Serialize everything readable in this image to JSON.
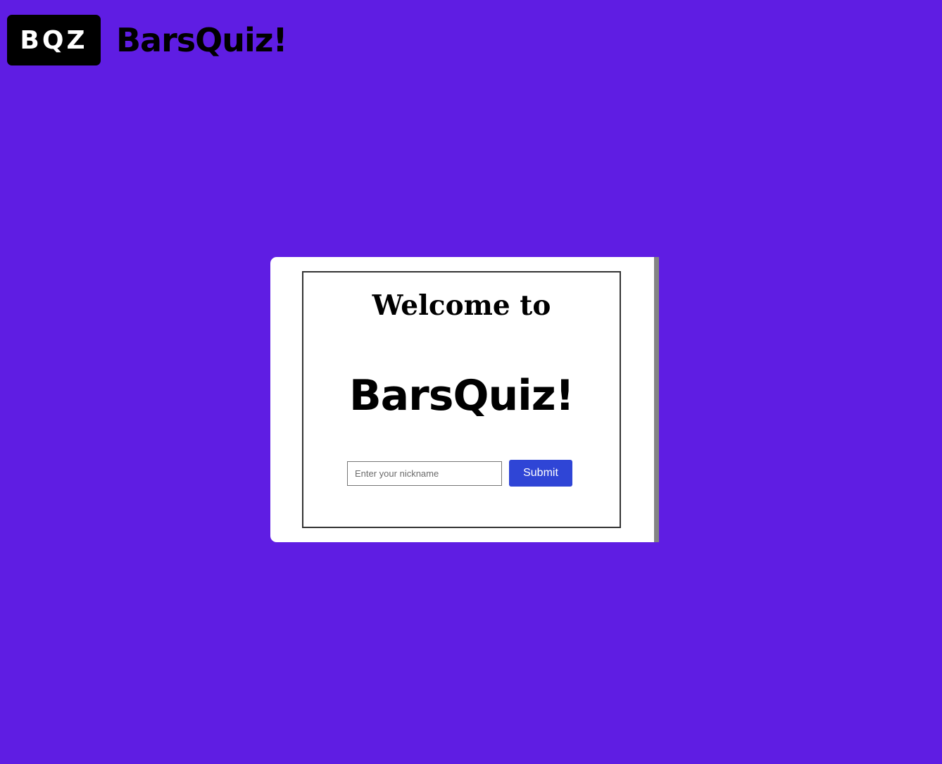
{
  "header": {
    "badge_text": "BQZ",
    "wordmark": "BarsQuiz!"
  },
  "card": {
    "welcome_text": "Welcome to",
    "wordmark": "BarsQuiz!",
    "nickname_placeholder": "Enter your nickname",
    "nickname_value": "",
    "submit_label": "Submit"
  },
  "colors": {
    "background": "#5f1de3",
    "card": "#ffffff",
    "submit_button": "#2f45d6",
    "logo_badge": "#000000"
  }
}
